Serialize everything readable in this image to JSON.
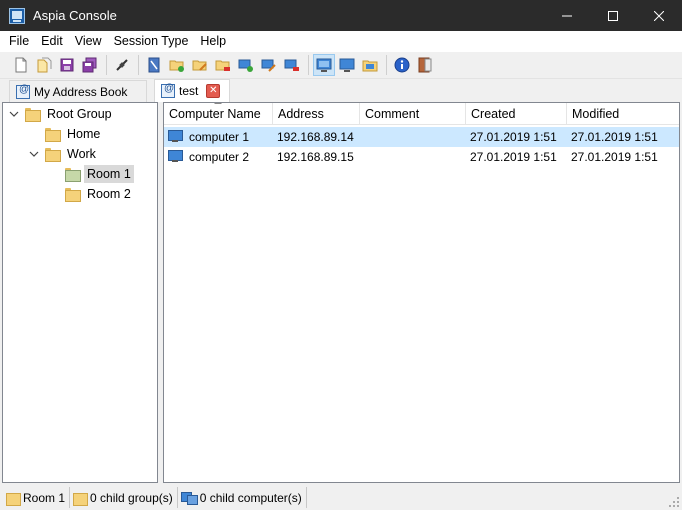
{
  "window": {
    "title": "Aspia Console"
  },
  "menu": [
    "File",
    "Edit",
    "View",
    "Session Type",
    "Help"
  ],
  "tabs": [
    {
      "label": "My Address Book"
    },
    {
      "label": "test"
    }
  ],
  "tree": {
    "root": "Root Group",
    "home": "Home",
    "work": "Work",
    "room1": "Room 1",
    "room2": "Room 2"
  },
  "table": {
    "columns": [
      "Computer Name",
      "Address",
      "Comment",
      "Created",
      "Modified"
    ],
    "rows": [
      {
        "name": "computer 1",
        "address": "192.168.89.14",
        "comment": "",
        "created": "27.01.2019 1:51",
        "modified": "27.01.2019 1:51"
      },
      {
        "name": "computer 2",
        "address": "192.168.89.15",
        "comment": "",
        "created": "27.01.2019 1:51",
        "modified": "27.01.2019 1:51"
      }
    ]
  },
  "status": {
    "group": "Room 1",
    "child_groups": "0 child group(s)",
    "child_computers": "0 child computer(s)"
  },
  "colors": {
    "titlebar": "#2b2b2b",
    "selection": "#cce8ff",
    "close_tab": "#e35b4f"
  }
}
